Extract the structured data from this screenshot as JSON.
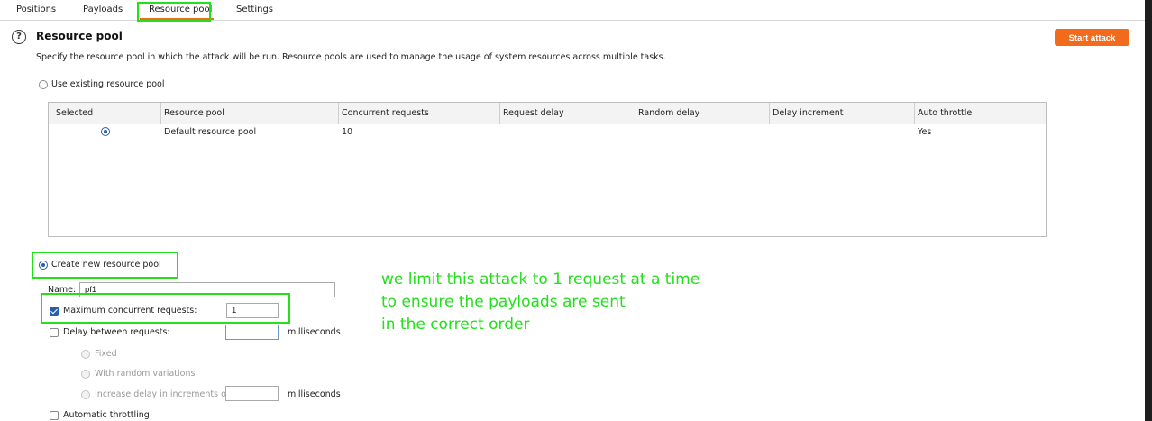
{
  "tabs": [
    {
      "label": "Positions"
    },
    {
      "label": "Payloads"
    },
    {
      "label": "Resource pool"
    },
    {
      "label": "Settings"
    }
  ],
  "section": {
    "title": "Resource pool",
    "description": "Specify the resource pool in which the attack will be run. Resource pools are used to manage the usage of system resources across multiple tasks.",
    "start_button": "Start attack"
  },
  "existing_pool": {
    "radio_label": "Use existing resource pool",
    "columns": [
      "Selected",
      "Resource pool",
      "Concurrent requests",
      "Request delay",
      "Random delay",
      "Delay increment",
      "Auto throttle"
    ],
    "rows": [
      {
        "resource_pool": "Default resource pool",
        "concurrent_requests": "10",
        "request_delay": "",
        "random_delay": "",
        "delay_increment": "",
        "auto_throttle": "Yes"
      }
    ]
  },
  "new_pool": {
    "radio_label": "Create new resource pool",
    "name_label": "Name:",
    "name_value": "pf1",
    "max_concurrent_label": "Maximum concurrent requests:",
    "max_concurrent_value": "1",
    "delay_label": "Delay between requests:",
    "delay_value": "",
    "delay_units": "milliseconds",
    "fixed_label": "Fixed",
    "random_label": "With random variations",
    "increase_label": "Increase delay in increments of",
    "increase_value": "",
    "increase_units": "milliseconds",
    "auto_throttle_label": "Automatic throttling"
  },
  "annotation": {
    "line1": "we limit this attack to 1 request at a time",
    "line2": "to ensure the payloads are sent",
    "line3": "in the correct order"
  },
  "colors": {
    "accent": "#f26a1b",
    "annotation": "#22e01a",
    "radio_selected": "#2a5db0"
  }
}
